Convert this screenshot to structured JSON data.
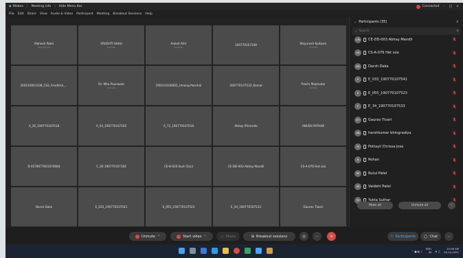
{
  "titlebar": {
    "app": "Webex",
    "meeting_info": "Meeting info",
    "hide_menu": "Hide Menu Bar",
    "connected": "Connected"
  },
  "menubar": [
    "File",
    "Edit",
    "Share",
    "View",
    "Audio & Video",
    "Participant",
    "Meeting",
    "Breakout Sessions",
    "Help"
  ],
  "tiles": [
    {
      "name": "Mahesh Patel",
      "sub": "Unmute me"
    },
    {
      "name": "VRUSHTI SHAH",
      "sub": "Unmute"
    },
    {
      "name": "Aniket Ahir",
      "sub": "Unmute"
    },
    {
      "name": "190770107108",
      "sub": ""
    },
    {
      "name": "Mayuresh Kulkarni",
      "sub": "Unmute"
    },
    {
      "name": "200210001108_CS2_Aradhish_...",
      "sub": ""
    },
    {
      "name": "Dr. Mita Paunwala",
      "sub": "Unmute"
    },
    {
      "name": "200210100005_Umang Panchal",
      "sub": ""
    },
    {
      "name": "200770107532_Kamal",
      "sub": ""
    },
    {
      "name": "Prachi Majmudar",
      "sub": "Unmute"
    },
    {
      "name": "A_26_190770107018",
      "sub": ""
    },
    {
      "name": "A_54_190770107165",
      "sub": ""
    },
    {
      "name": "A_72_190770107016",
      "sub": ""
    },
    {
      "name": "Abhay Pitroroda",
      "sub": ""
    },
    {
      "name": "ANUSH PATHAK",
      "sub": ""
    },
    {
      "name": "B-0578077001070084",
      "sub": ""
    },
    {
      "name": "C_06 190770107164",
      "sub": ""
    },
    {
      "name": "CE-B-020 Kush Darji",
      "sub": ""
    },
    {
      "name": "CE-DD-003 Abhay Mandli",
      "sub": ""
    },
    {
      "name": "CS-A-076 Het oza",
      "sub": ""
    },
    {
      "name": "Darsh Dake",
      "sub": ""
    },
    {
      "name": "E_033_190770107541",
      "sub": ""
    },
    {
      "name": "E_055_190770107523",
      "sub": ""
    },
    {
      "name": "E_34_190770107533",
      "sub": ""
    },
    {
      "name": "Gaurav Tiwari",
      "sub": ""
    }
  ],
  "panel": {
    "title": "Participants (35)",
    "search_placeholder": "Search",
    "participants": [
      {
        "initials": "CM",
        "name": "CE-DD-003 Abhay Mandli"
      },
      {
        "initials": "CH",
        "name": "CS-A-076 Het oza"
      },
      {
        "initials": "DD",
        "name": "Darsh Dake"
      },
      {
        "initials": "E",
        "name": "E_033_190770107541"
      },
      {
        "initials": "E",
        "name": "E_055_190770107523"
      },
      {
        "initials": "E",
        "name": "E_34_190770107533"
      },
      {
        "initials": "GT",
        "name": "Gaurav Tivari"
      },
      {
        "initials": "HB",
        "name": "harshkumar bhingradiya"
      },
      {
        "initials": "PJ",
        "name": "Pottayil Chrissa Jose"
      },
      {
        "initials": "R",
        "name": "Rohan"
      },
      {
        "initials": "RP",
        "name": "Rutul Patel"
      },
      {
        "initials": "VP",
        "name": "Vaidehi Patel"
      },
      {
        "initials": "YS",
        "name": "Yukta Suthar"
      }
    ],
    "mute_all": "Mute all",
    "unmute_all": "Unmute all"
  },
  "toolbar": {
    "unmute": "Unmute",
    "start_video": "Start video",
    "share": "Share",
    "breakout": "Breakout sessions",
    "participants": "Participants",
    "chat": "Chat"
  },
  "taskbar": {
    "lang": "ENG",
    "lang2": "IN",
    "time": "10:08 AM",
    "date": "16-10-2021"
  },
  "colors": {
    "accent_red": "#d94b45",
    "mute_red": "#e0453a"
  }
}
